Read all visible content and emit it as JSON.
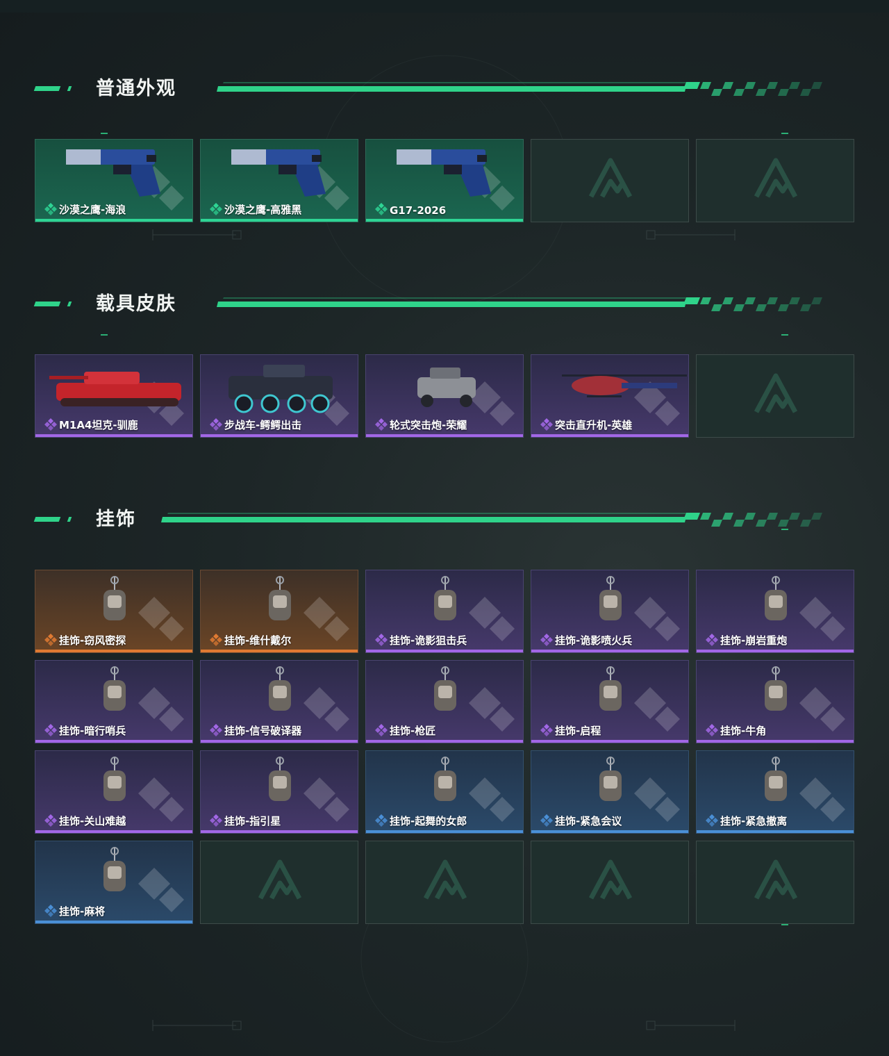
{
  "sections": [
    {
      "title": "普通外观",
      "items": [
        {
          "label": "沙漠之鹰-海浪",
          "rarity": "green",
          "icon": "pistol-icon"
        },
        {
          "label": "沙漠之鹰-高雅黑",
          "rarity": "green",
          "icon": "pistol-icon"
        },
        {
          "label": "G17-2026",
          "rarity": "green",
          "icon": "pistol-icon"
        },
        {
          "label": "",
          "rarity": "empty",
          "icon": "logo-icon"
        },
        {
          "label": "",
          "rarity": "empty",
          "icon": "logo-icon"
        }
      ]
    },
    {
      "title": "载具皮肤",
      "items": [
        {
          "label": "M1A4坦克-驯鹿",
          "rarity": "purple",
          "icon": "tank-icon"
        },
        {
          "label": "步战车-鳄鳄出击",
          "rarity": "purple",
          "icon": "ifv-icon"
        },
        {
          "label": "轮式突击炮-荣耀",
          "rarity": "purple",
          "icon": "armored-car-icon"
        },
        {
          "label": "突击直升机-英雄",
          "rarity": "purple",
          "icon": "helicopter-icon"
        },
        {
          "label": "",
          "rarity": "empty",
          "icon": "logo-icon"
        }
      ]
    },
    {
      "title": "挂饰",
      "items": [
        {
          "label": "挂饰-窃风密探",
          "rarity": "orange",
          "icon": "charm-icon"
        },
        {
          "label": "挂饰-维什戴尔",
          "rarity": "orange",
          "icon": "charm-icon"
        },
        {
          "label": "挂饰-诡影狙击兵",
          "rarity": "purple",
          "icon": "charm-icon"
        },
        {
          "label": "挂饰-诡影喷火兵",
          "rarity": "purple",
          "icon": "charm-icon"
        },
        {
          "label": "挂饰-崩岩重炮",
          "rarity": "purple",
          "icon": "charm-icon"
        },
        {
          "label": "挂饰-暗行哨兵",
          "rarity": "purple",
          "icon": "charm-icon"
        },
        {
          "label": "挂饰-信号破译器",
          "rarity": "purple",
          "icon": "charm-icon"
        },
        {
          "label": "挂饰-枪匠",
          "rarity": "purple",
          "icon": "charm-icon"
        },
        {
          "label": "挂饰-启程",
          "rarity": "purple",
          "icon": "charm-icon"
        },
        {
          "label": "挂饰-牛角",
          "rarity": "purple",
          "icon": "charm-icon"
        },
        {
          "label": "挂饰-关山难越",
          "rarity": "purple",
          "icon": "charm-icon"
        },
        {
          "label": "挂饰-指引星",
          "rarity": "purple",
          "icon": "charm-icon"
        },
        {
          "label": "挂饰-起舞的女郎",
          "rarity": "blue",
          "icon": "charm-icon"
        },
        {
          "label": "挂饰-紧急会议",
          "rarity": "blue",
          "icon": "charm-icon"
        },
        {
          "label": "挂饰-紧急撤离",
          "rarity": "blue",
          "icon": "charm-icon"
        },
        {
          "label": "挂饰-麻将",
          "rarity": "blue",
          "icon": "charm-icon"
        },
        {
          "label": "",
          "rarity": "empty",
          "icon": "logo-icon"
        },
        {
          "label": "",
          "rarity": "empty",
          "icon": "logo-icon"
        },
        {
          "label": "",
          "rarity": "empty",
          "icon": "logo-icon"
        },
        {
          "label": "",
          "rarity": "empty",
          "icon": "logo-icon"
        }
      ]
    }
  ],
  "colors": {
    "accent": "#2fd38a",
    "green": "#2ed494",
    "purple": "#a267e6",
    "orange": "#e07a32",
    "blue": "#4a8fd6"
  }
}
